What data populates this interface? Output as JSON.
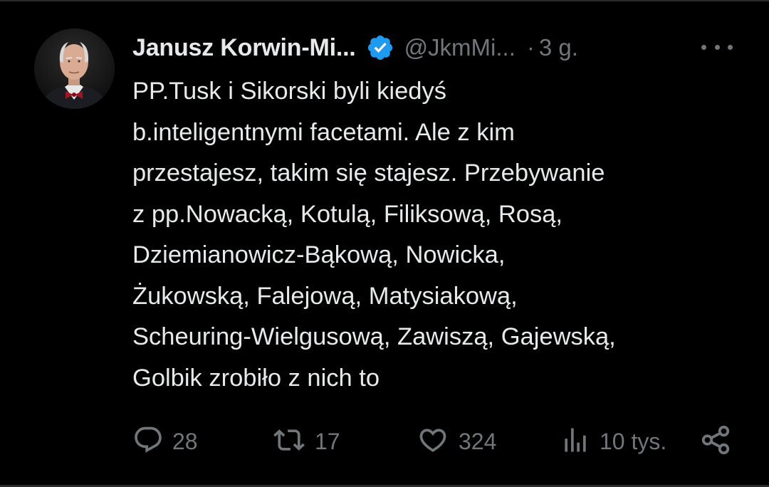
{
  "author": {
    "display_name": "Janusz Korwin-Mi...",
    "handle": "@JkmMi...",
    "separator": "·",
    "time": "3 g.",
    "verified": true
  },
  "tweet": {
    "lines": [
      "PP.Tusk i Sikorski byli kiedyś",
      "b.inteligentnymi facetami. Ale z kim",
      "przestajesz, takim się stajesz. Przebywanie",
      "z pp.Nowacką, Kotulą, Filiksową, Rosą,",
      "Dziemianowicz-Bąkową, Nowicka,",
      "Żukowską, Falejową, Matysiakową,",
      "Scheuring-Wielgusową, Zawiszą, Gajewską,",
      "Golbik zrobiło z nich to"
    ]
  },
  "actions": {
    "replies": "28",
    "reposts": "17",
    "likes": "324",
    "views": "10 tys."
  },
  "colors": {
    "background": "#000000",
    "text": "#e7e9ea",
    "muted": "#71767b",
    "verified": "#1d9bf0"
  },
  "icons": [
    "more-icon",
    "verified-badge-icon",
    "reply-icon",
    "repost-icon",
    "like-icon",
    "views-icon",
    "share-icon"
  ]
}
